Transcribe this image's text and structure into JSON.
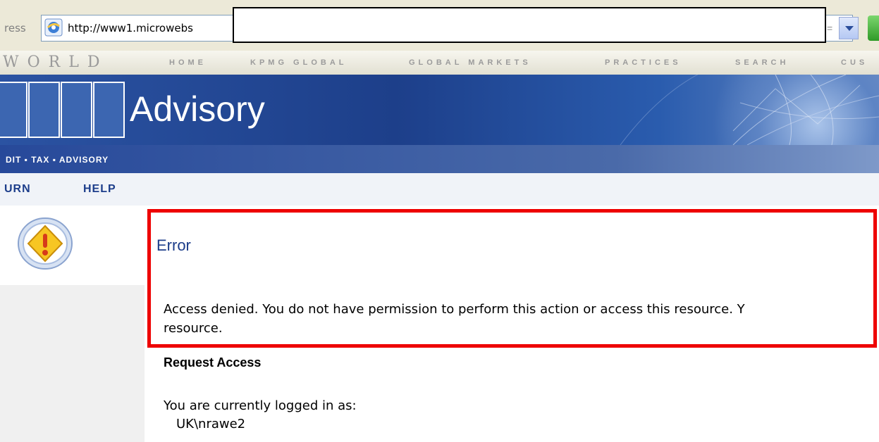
{
  "browser": {
    "address_label": "ress",
    "url": "http://www1.microwebs",
    "url_trail": "="
  },
  "topnav": {
    "brand": "WORLD",
    "items": [
      "HOME",
      "KPMG GLOBAL",
      "GLOBAL MARKETS",
      "PRACTICES",
      "SEARCH",
      "CUS"
    ]
  },
  "banner": {
    "title": "Advisory",
    "tagline": "DIT ▪ TAX ▪ ADVISORY"
  },
  "subnav": {
    "items": [
      "URN",
      "HELP"
    ]
  },
  "error": {
    "title": "Error",
    "line1": "Access denied. You do not have permission to perform this action or access this resource. Y",
    "line2": "resource."
  },
  "request": {
    "title": "Request Access",
    "logged_label": "You are currently logged in as:",
    "user": "UK\\nrawe2"
  },
  "colors": {
    "highlight": "#ee0000",
    "link": "#1c3d8a",
    "banner": "#1d3f8a"
  }
}
